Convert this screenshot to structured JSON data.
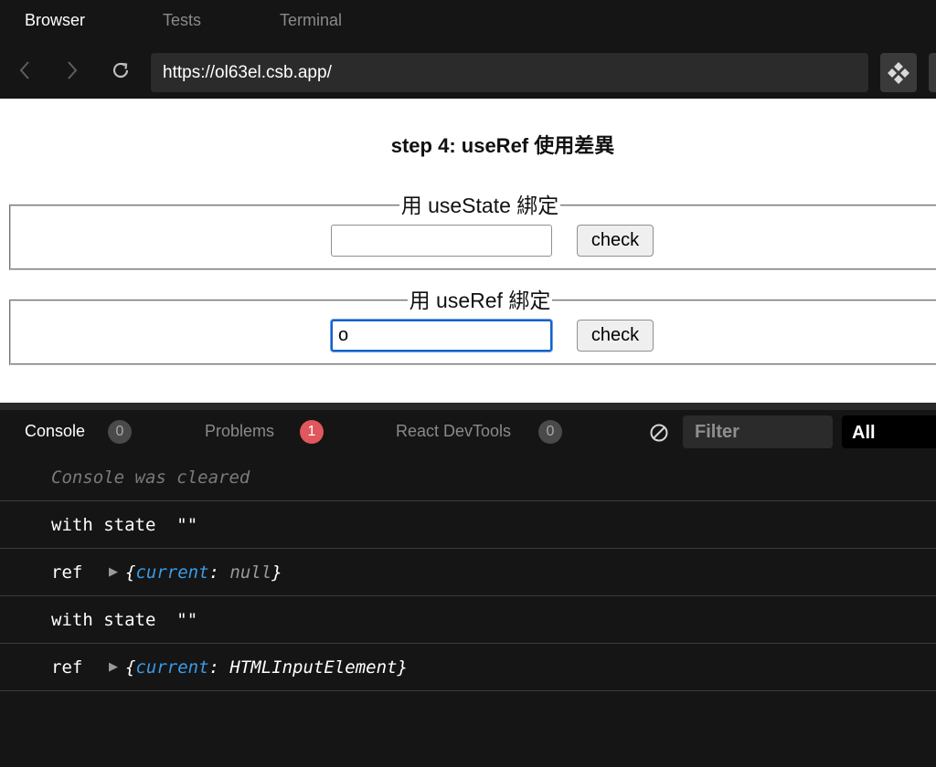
{
  "tabs": {
    "browser": "Browser",
    "tests": "Tests",
    "terminal": "Terminal"
  },
  "address": {
    "url": "https://ol63el.csb.app/"
  },
  "preview": {
    "title": "step 4: useRef 使用差異",
    "state_group": {
      "legend": "用 useState 綁定",
      "input_value": "",
      "button": "check"
    },
    "ref_group": {
      "legend": "用 useRef 綁定",
      "input_value": "o",
      "button": "check"
    }
  },
  "console": {
    "tabs": {
      "console": "Console",
      "console_count": "0",
      "problems": "Problems",
      "problems_count": "1",
      "devtools": "React DevTools",
      "devtools_count": "0"
    },
    "filter_placeholder": "Filter",
    "level": "All",
    "logs": {
      "cleared": "Console was cleared",
      "row1": "with state  \"\"",
      "row2_label": "ref",
      "row2_open": "{",
      "row2_key": "current",
      "row2_sep": ": ",
      "row2_value": "null",
      "row2_close": "}",
      "row3": "with state  \"\"",
      "row4_label": "ref",
      "row4_open": "{",
      "row4_key": "current",
      "row4_sep": ": ",
      "row4_value": "HTMLInputElement",
      "row4_close": "}",
      "toggle": "▶"
    }
  }
}
